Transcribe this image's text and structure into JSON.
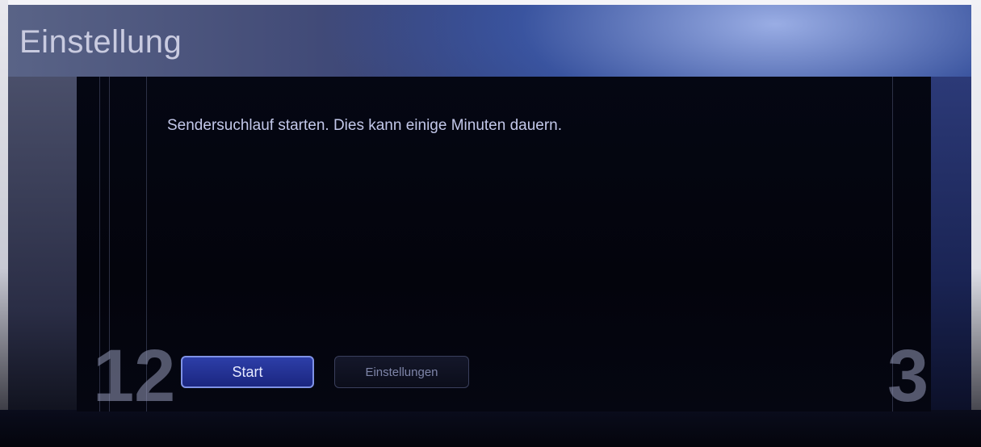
{
  "header": {
    "title": "Einstellung"
  },
  "dialog": {
    "message": "Sendersuchlauf starten. Dies kann einige Minuten dauern.",
    "buttons": {
      "start_label": "Start",
      "settings_label": "Einstellungen"
    },
    "decor": {
      "left_number": "12",
      "right_number": "3"
    }
  },
  "colors": {
    "accent_button": "#2d3ea8",
    "accent_border": "#7f92e6",
    "message_text": "#c3c8ea"
  }
}
